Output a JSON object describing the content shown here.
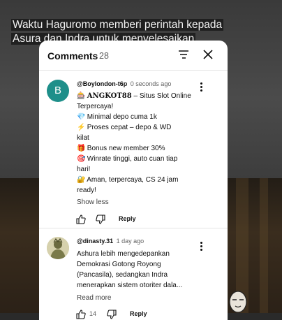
{
  "video": {
    "caption_lines": [
      "Waktu Haguromo memberi perintah kepada",
      "Asura dan Indra untuk menyelesaikan"
    ]
  },
  "comments_panel": {
    "title": "Comments",
    "count": "28",
    "sort_icon": "sort-icon",
    "close_icon": "close-icon",
    "comments": [
      {
        "avatar_letter": "B",
        "avatar_color": "#1e8f8a",
        "author": "@Boylondon-t6p",
        "time": "0 seconds ago",
        "brand": "ANGKOT88",
        "lines": [
          {
            "emoji": "🎰",
            "text": " – Situs Slot Online"
          },
          {
            "emoji": "",
            "text": "Terpercaya!"
          },
          {
            "emoji": "💎",
            "text": "Minimal depo cuma 1k"
          },
          {
            "emoji": "⚡",
            "text": "Proses cepat – depo & WD"
          },
          {
            "emoji": "",
            "text": "kilat"
          },
          {
            "emoji": "🎁",
            "text": "Bonus new member 30%"
          },
          {
            "emoji": "🎯",
            "text": "Winrate tinggi, auto cuan tiap"
          },
          {
            "emoji": "",
            "text": "hari!"
          },
          {
            "emoji": "🔐",
            "text": "Aman, terpercaya, CS 24 jam"
          },
          {
            "emoji": "",
            "text": "ready!"
          }
        ],
        "toggle": "Show less",
        "like_count": "",
        "reply_label": "Reply"
      },
      {
        "author": "@dinasty.31",
        "time": "1 day ago",
        "lines": [
          {
            "text": "Ashura lebih mengedepankan"
          },
          {
            "text": "Demokrasi Gotong Royong"
          },
          {
            "text": "(Pancasila), sedangkan Indra"
          },
          {
            "text": "menerapkan sistem otoriter dala..."
          }
        ],
        "toggle": "Read more",
        "like_count": "14",
        "reply_label": "Reply"
      }
    ]
  }
}
